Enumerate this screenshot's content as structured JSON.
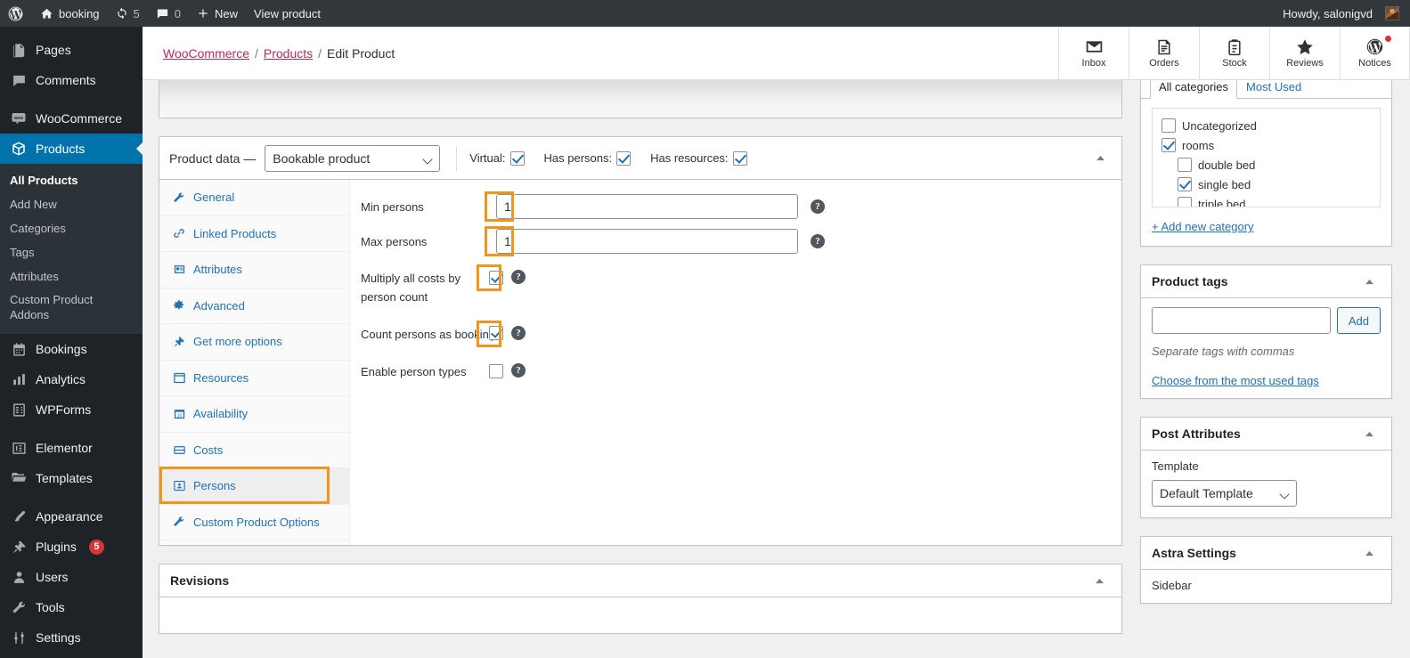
{
  "adminbar": {
    "site_name": "booking",
    "updates_count": "5",
    "comments_count": "0",
    "new_label": "New",
    "view_product_label": "View product",
    "howdy": "Howdy, salonigvd"
  },
  "sidebar": {
    "items": [
      {
        "label": "Pages",
        "icon": "pages-icon",
        "current": false
      },
      {
        "label": "Comments",
        "icon": "comments-icon",
        "current": false
      },
      {
        "label": "WooCommerce",
        "icon": "woocommerce-icon",
        "current": false
      },
      {
        "label": "Products",
        "icon": "products-icon",
        "current": true
      },
      {
        "label": "Bookings",
        "icon": "calendar-icon",
        "current": false
      },
      {
        "label": "Analytics",
        "icon": "analytics-icon",
        "current": false
      },
      {
        "label": "WPForms",
        "icon": "wpforms-icon",
        "current": false
      },
      {
        "label": "Elementor",
        "icon": "elementor-icon",
        "current": false
      },
      {
        "label": "Templates",
        "icon": "folder-icon",
        "current": false
      },
      {
        "label": "Appearance",
        "icon": "brush-icon",
        "current": false
      },
      {
        "label": "Plugins",
        "icon": "plugins-icon",
        "current": false,
        "badge": "5"
      },
      {
        "label": "Users",
        "icon": "users-icon",
        "current": false
      },
      {
        "label": "Tools",
        "icon": "tools-icon",
        "current": false
      },
      {
        "label": "Settings",
        "icon": "settings-icon",
        "current": false
      }
    ],
    "products_submenu": [
      {
        "label": "All Products",
        "current": true
      },
      {
        "label": "Add New",
        "current": false
      },
      {
        "label": "Categories",
        "current": false
      },
      {
        "label": "Tags",
        "current": false
      },
      {
        "label": "Attributes",
        "current": false
      },
      {
        "label": "Custom Product Addons",
        "current": false
      }
    ]
  },
  "header": {
    "breadcrumb": {
      "root": "WooCommerce",
      "parent": "Products",
      "current": "Edit Product"
    },
    "actions": [
      {
        "label": "Inbox",
        "icon": "inbox-icon",
        "badge": true
      },
      {
        "label": "Orders",
        "icon": "orders-icon",
        "badge": false
      },
      {
        "label": "Stock",
        "icon": "stock-icon",
        "badge": false
      },
      {
        "label": "Reviews",
        "icon": "star-icon",
        "badge": false
      },
      {
        "label": "Notices",
        "icon": "wordpress-icon",
        "badge": true
      }
    ]
  },
  "product_data": {
    "title": "Product data —",
    "type_selected": "Bookable product",
    "type_options": [
      "Bookable product"
    ],
    "flags": [
      {
        "label": "Virtual:",
        "checked": true
      },
      {
        "label": "Has persons:",
        "checked": true
      },
      {
        "label": "Has resources:",
        "checked": true
      }
    ],
    "tabs": [
      {
        "label": "General",
        "icon": "wrench-icon",
        "active": false,
        "highlighted": false
      },
      {
        "label": "Linked Products",
        "icon": "link-icon",
        "active": false,
        "highlighted": false
      },
      {
        "label": "Attributes",
        "icon": "attributes-icon",
        "active": false,
        "highlighted": false
      },
      {
        "label": "Advanced",
        "icon": "gear-icon",
        "active": false,
        "highlighted": false
      },
      {
        "label": "Get more options",
        "icon": "plug-icon",
        "active": false,
        "highlighted": false
      },
      {
        "label": "Resources",
        "icon": "window-icon",
        "active": false,
        "highlighted": false
      },
      {
        "label": "Availability",
        "icon": "calendar-icon",
        "active": false,
        "highlighted": false
      },
      {
        "label": "Costs",
        "icon": "costs-icon",
        "active": false,
        "highlighted": false
      },
      {
        "label": "Persons",
        "icon": "person-icon",
        "active": true,
        "highlighted": true
      },
      {
        "label": "Custom Product Options",
        "icon": "wrench-icon",
        "active": false,
        "highlighted": false
      }
    ],
    "persons_panel": {
      "min_persons": {
        "label": "Min persons",
        "value": "1",
        "highlighted": true
      },
      "max_persons": {
        "label": "Max persons",
        "value": "1",
        "highlighted": true
      },
      "multiply_costs": {
        "label": "Multiply all costs by person count",
        "checked": true,
        "highlighted": true
      },
      "count_as_bookings": {
        "label": "Count persons as bookings",
        "checked": true,
        "highlighted": true
      },
      "enable_person_types": {
        "label": "Enable person types",
        "checked": false,
        "highlighted": false
      }
    },
    "help_tip": "?"
  },
  "revisions": {
    "title": "Revisions"
  },
  "side": {
    "categories": {
      "tabs": [
        {
          "label": "All categories",
          "active": true
        },
        {
          "label": "Most Used",
          "active": false
        }
      ],
      "items": [
        {
          "label": "Uncategorized",
          "checked": false,
          "child": false
        },
        {
          "label": "rooms",
          "checked": true,
          "child": false
        },
        {
          "label": "double bed",
          "checked": false,
          "child": true
        },
        {
          "label": "single bed",
          "checked": true,
          "child": true
        },
        {
          "label": "triple bed",
          "checked": false,
          "child": true
        }
      ],
      "add_new_link": "+ Add new category"
    },
    "product_tags": {
      "title": "Product tags",
      "input_value": "",
      "add_label": "Add",
      "hint": "Separate tags with commas",
      "choose_link": "Choose from the most used tags"
    },
    "post_attributes": {
      "title": "Post Attributes",
      "template_label": "Template",
      "template_selected": "Default Template",
      "template_options": [
        "Default Template"
      ]
    },
    "astra_settings": {
      "title": "Astra Settings",
      "sidebar_label": "Sidebar"
    }
  },
  "colors": {
    "highlight_orange": "#f0961e",
    "wp_blue": "#2271b1",
    "admin_active": "#0073aa",
    "link_pink": "#bb2a5c",
    "badge_red": "#d63638"
  }
}
